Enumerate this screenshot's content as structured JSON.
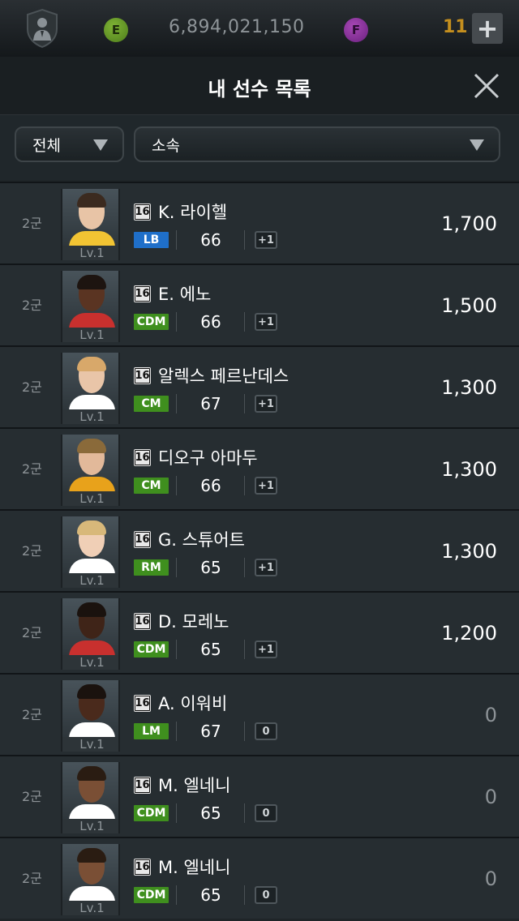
{
  "topbar": {
    "coin_e_label": "E",
    "coin_e_amount": "6,894,021,150",
    "coin_f_label": "F",
    "coin_f_amount": "11",
    "add_label": "+"
  },
  "header": {
    "title": "내 선수 목록"
  },
  "filters": {
    "all_label": "전체",
    "team_label": "소속"
  },
  "colors": {
    "pos_blue": "#1f6fc9",
    "pos_green": "#3f8f1e",
    "price_zero": "#8d9397"
  },
  "players": [
    {
      "squad": "2군",
      "season": "16",
      "name": "K. 라이헬",
      "pos": "LB",
      "pos_color": "blue",
      "ovr": "66",
      "enh": "+1",
      "price": "1,700",
      "level": "Lv.1"
    },
    {
      "squad": "2군",
      "season": "16",
      "name": "E. 에노",
      "pos": "CDM",
      "pos_color": "green",
      "ovr": "66",
      "enh": "+1",
      "price": "1,500",
      "level": "Lv.1"
    },
    {
      "squad": "2군",
      "season": "16",
      "name": "알렉스 페르난데스",
      "pos": "CM",
      "pos_color": "green",
      "ovr": "67",
      "enh": "+1",
      "price": "1,300",
      "level": "Lv.1"
    },
    {
      "squad": "2군",
      "season": "16",
      "name": "디오구 아마두",
      "pos": "CM",
      "pos_color": "green",
      "ovr": "66",
      "enh": "+1",
      "price": "1,300",
      "level": "Lv.1"
    },
    {
      "squad": "2군",
      "season": "16",
      "name": "G. 스튜어트",
      "pos": "RM",
      "pos_color": "green",
      "ovr": "65",
      "enh": "+1",
      "price": "1,300",
      "level": "Lv.1"
    },
    {
      "squad": "2군",
      "season": "16",
      "name": "D. 모레노",
      "pos": "CDM",
      "pos_color": "green",
      "ovr": "65",
      "enh": "+1",
      "price": "1,200",
      "level": "Lv.1"
    },
    {
      "squad": "2군",
      "season": "16",
      "name": "A. 이워비",
      "pos": "LM",
      "pos_color": "green",
      "ovr": "67",
      "enh": "0",
      "price": "0",
      "level": "Lv.1"
    },
    {
      "squad": "2군",
      "season": "16",
      "name": "M. 엘네니",
      "pos": "CDM",
      "pos_color": "green",
      "ovr": "65",
      "enh": "0",
      "price": "0",
      "level": "Lv.1"
    },
    {
      "squad": "2군",
      "season": "16",
      "name": "M. 엘네니",
      "pos": "CDM",
      "pos_color": "green",
      "ovr": "65",
      "enh": "0",
      "price": "0",
      "level": "Lv.1"
    }
  ]
}
